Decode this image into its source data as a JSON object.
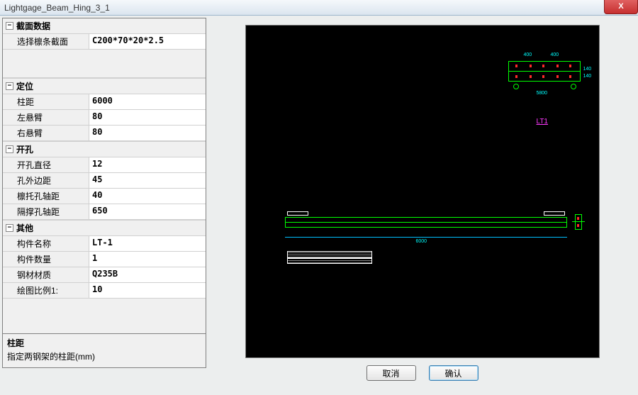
{
  "window": {
    "title": "Lightgage_Beam_Hing_3_1",
    "close": "X"
  },
  "groups": {
    "section": {
      "title": "截面数据",
      "profile": {
        "label": "选择檩条截面",
        "value": "C200*70*20*2.5"
      }
    },
    "position": {
      "title": "定位",
      "colSpan": {
        "label": "柱距",
        "value": "6000"
      },
      "leftCant": {
        "label": "左悬臂",
        "value": "80"
      },
      "rightCant": {
        "label": "右悬臂",
        "value": "80"
      }
    },
    "holes": {
      "title": "开孔",
      "diameter": {
        "label": "开孔直径",
        "value": "12"
      },
      "edgeDist": {
        "label": "孔外边距",
        "value": "45"
      },
      "bracketDist": {
        "label": "檩托孔轴距",
        "value": "40"
      },
      "braceDist": {
        "label": "隔撑孔轴距",
        "value": "650"
      }
    },
    "other": {
      "title": "其他",
      "name": {
        "label": "构件名称",
        "value": "LT-1"
      },
      "qty": {
        "label": "构件数量",
        "value": "1"
      },
      "material": {
        "label": "钢材材质",
        "value": "Q235B"
      },
      "scale": {
        "label": "绘图比例1:",
        "value": "10"
      }
    }
  },
  "desc": {
    "title": "柱距",
    "text": "指定两钢架的柱距(mm)"
  },
  "buttons": {
    "cancel": "取消",
    "ok": "确认"
  },
  "canvas": {
    "label": "LT1"
  }
}
